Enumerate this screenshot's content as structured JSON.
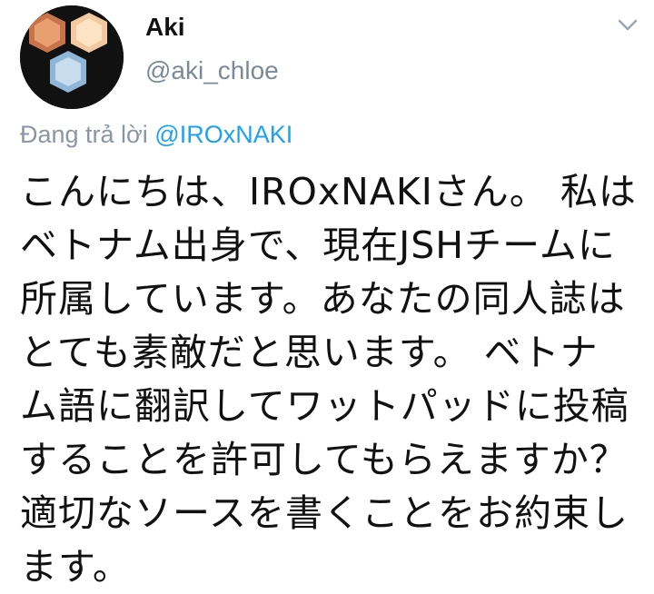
{
  "tweet": {
    "author_name": "Aki",
    "author_handle": "@aki_chloe",
    "reply_prefix": "Đang trả lời",
    "reply_to": "@IROxNAKI",
    "text_lines": [
      "こんにちは、IROxNAKIさん。 私は",
      "ベトナム出身で、現在JSHチームに",
      "所属しています。あなたの同人誌は",
      "とても素敵だと思います。 ベトナ",
      "ム語に翻訳してワットパッドに投稿",
      "することを許可してもらえますか？",
      "適切なソースを書くことをお約束し",
      "ます。"
    ]
  },
  "icons": {
    "avatar": "avatar-collage",
    "more": "chevron-down-icon"
  },
  "colors": {
    "handle": "#7b8a97",
    "mention": "#1da1f2",
    "text": "#111111"
  }
}
